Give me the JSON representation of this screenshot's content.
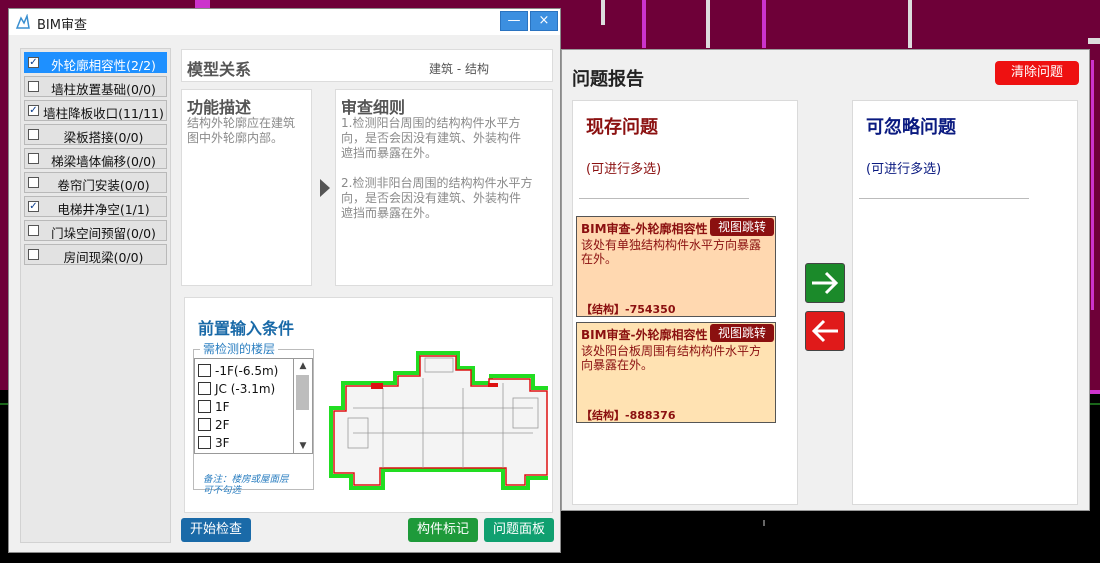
{
  "left_window": {
    "title": "BIM审查",
    "minimize_label": "—",
    "close_label": "×",
    "rules": [
      {
        "label": "外轮廓相容性(2/2)",
        "checked": true,
        "selected": true
      },
      {
        "label": "墙柱放置基础(0/0)",
        "checked": false
      },
      {
        "label": "墙柱降板收口(11/11)",
        "checked": true
      },
      {
        "label": "梁板搭接(0/0)",
        "checked": false
      },
      {
        "label": "梯梁墙体偏移(0/0)",
        "checked": false
      },
      {
        "label": "卷帘门安装(0/0)",
        "checked": false
      },
      {
        "label": "电梯井净空(1/1)",
        "checked": true
      },
      {
        "label": "门垛空间预留(0/0)",
        "checked": false
      },
      {
        "label": "房间现梁(0/0)",
        "checked": false
      }
    ],
    "model_relation": {
      "title": "模型关系",
      "value": "建筑 - 结构"
    },
    "function_desc": {
      "title": "功能描述",
      "lines": [
        "结构外轮廓应在建筑",
        "图中外轮廓内部。"
      ]
    },
    "review_rules": {
      "title": "审查细则",
      "lines": [
        "1.检测阳台周围的结构构件水平方",
        "向，是否会因没有建筑、外装构件",
        "遮挡而暴露在外。",
        "",
        "2.检测非阳台周围的结构构件水平方",
        "向，是否会因没有建筑、外装构件",
        "遮挡而暴露在外。"
      ]
    },
    "preconditions": {
      "title": "前置输入条件",
      "floor_label": "需检测的楼层",
      "floors": [
        "-1F(-6.5m)",
        "JC (-3.1m)",
        "1F",
        "2F",
        "3F"
      ],
      "note_lines": [
        "备注：楼房或屋面层",
        "可不勾选"
      ]
    },
    "buttons": {
      "start": "开始检查",
      "mark": "构件标记",
      "panel": "问题面板"
    },
    "check_mark": "✓"
  },
  "report": {
    "title": "问题报告",
    "clear_button": "清除问题",
    "current": {
      "title": "现存问题",
      "hint": "(可进行多选)"
    },
    "ignorable": {
      "title": "可忽略问题",
      "hint": "(可进行多选)"
    },
    "issues": [
      {
        "title": "BIM审查-外轮廓相容性",
        "jump": "视图跳转",
        "desc_lines": [
          "该处有单独结构构件水平方向暴露",
          "在外。"
        ],
        "code": "【结构】-754350"
      },
      {
        "title": "BIM审查-外轮廓相容性",
        "jump": "视图跳转",
        "desc_lines": [
          "该处阳台板周围有结构构件水平方",
          "向暴露在外。"
        ],
        "code": "【结构】-888376"
      }
    ]
  },
  "colors": {
    "accent_blue": "#1a6aa8",
    "issue_red": "#8b1010",
    "ignorable_blue": "#0a1a80",
    "arrow_green": "#1b8a2a",
    "arrow_red": "#e01a1a",
    "cad_background": "#6e0038"
  }
}
